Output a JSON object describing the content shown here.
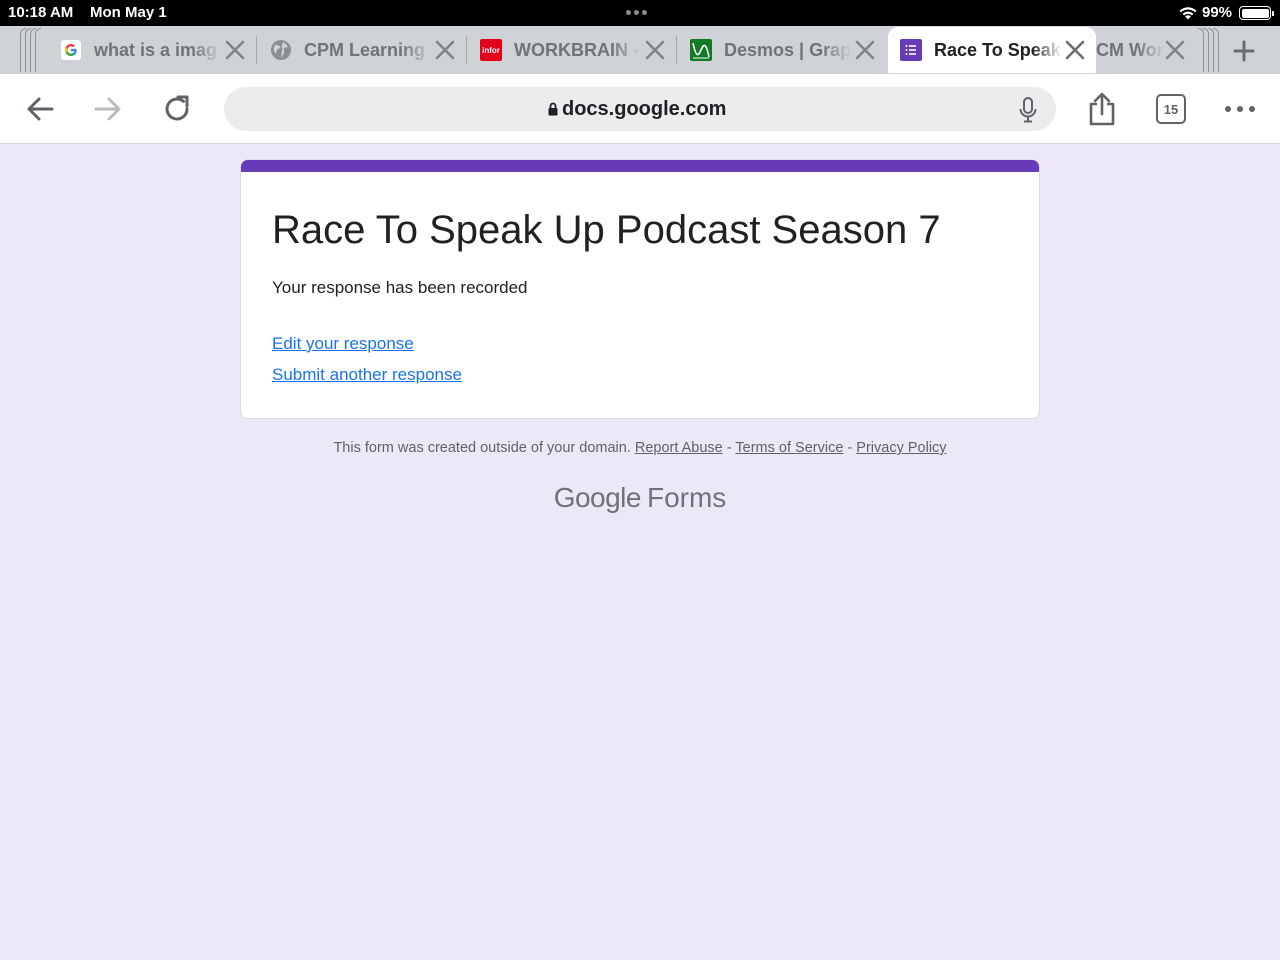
{
  "status_bar": {
    "time": "10:18 AM",
    "date": "Mon May 1",
    "battery": "99%",
    "battery_level": 0.99
  },
  "tabs": [
    {
      "title": "what is a imag",
      "favicon": "google-g-icon"
    },
    {
      "title": "CPM Learning",
      "favicon": "globe-icon"
    },
    {
      "title": "WORKBRAIN -",
      "favicon": "infor-icon",
      "favicon_text": "infor"
    },
    {
      "title": "Desmos | Grap",
      "favicon": "desmos-icon"
    },
    {
      "title": "Race To Speak",
      "favicon": "google-forms-icon",
      "active": true
    },
    {
      "title": "CM Wor",
      "favicon": "",
      "partial": true
    }
  ],
  "toolbar": {
    "url": "docs.google.com",
    "tab_count": "15"
  },
  "form": {
    "title": "Race To Speak Up Podcast Season 7",
    "message": "Your response has been recorded",
    "edit_link": "Edit your response",
    "submit_link": "Submit another response"
  },
  "footer": {
    "note": "This form was created outside of your domain.",
    "report_abuse": "Report Abuse",
    "separator": "-",
    "terms": "Terms of Service",
    "privacy": "Privacy Policy"
  },
  "logo": {
    "google": "Google",
    "forms": "Forms"
  },
  "colors": {
    "accent": "#673ab7",
    "page_background": "#ede8f8",
    "link": "#1a73e8"
  }
}
